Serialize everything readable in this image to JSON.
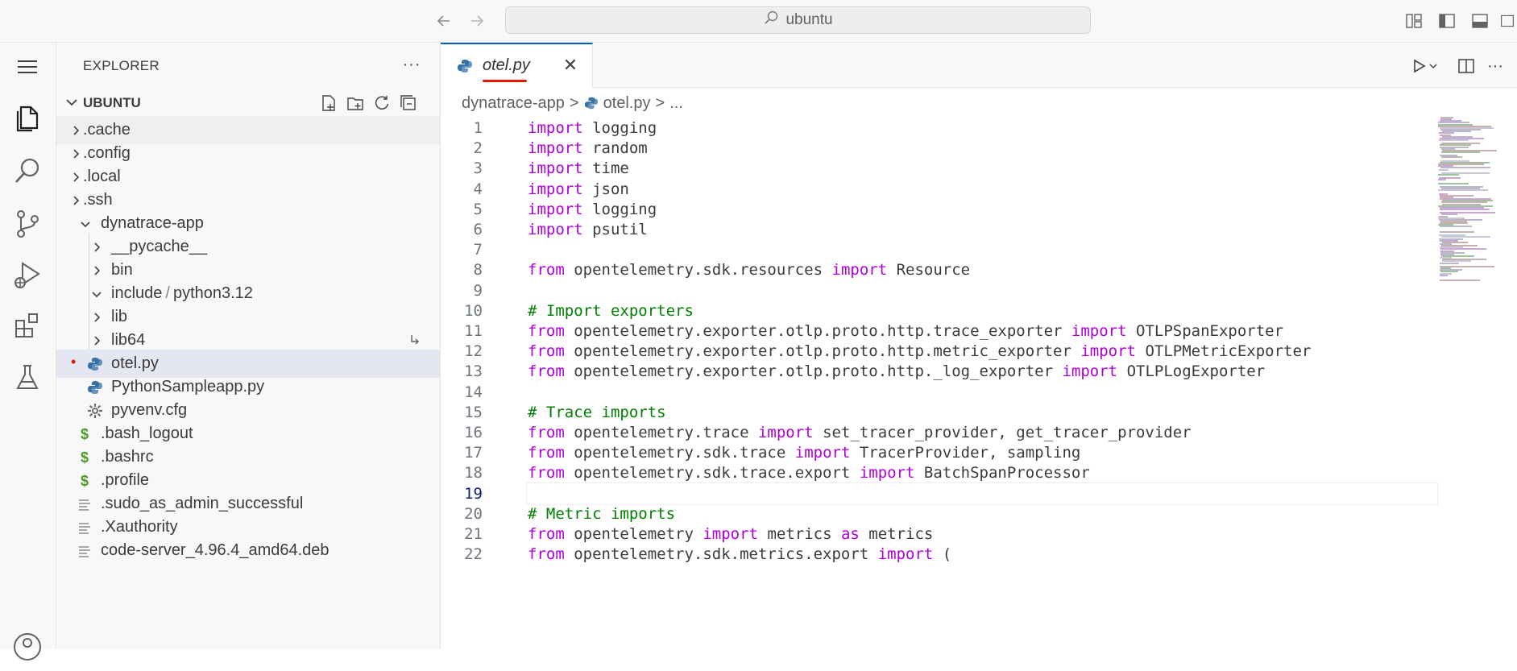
{
  "titlebar": {
    "search_text": "ubuntu",
    "icons": [
      "arrow-left-icon",
      "arrow-right-icon",
      "search-icon",
      "customize-layout-icon",
      "toggle-primary-sidebar-icon",
      "toggle-panel-icon",
      "toggle-secondary-sidebar-icon"
    ]
  },
  "activity_bar": {
    "items": [
      "menu",
      "explorer",
      "search",
      "source-control",
      "run-and-debug",
      "extensions",
      "testing",
      "accounts"
    ]
  },
  "sidebar": {
    "title": "EXPLORER",
    "workspace": "UBUNTU",
    "tree": [
      {
        "label": ".cache"
      },
      {
        "label": ".config"
      },
      {
        "label": ".local"
      },
      {
        "label": ".ssh"
      },
      {
        "label": "dynatrace-app"
      },
      {
        "label": "__pycache__"
      },
      {
        "label": "bin"
      },
      {
        "label": "include",
        "label2": "python3.12",
        "sep": "/"
      },
      {
        "label": "lib"
      },
      {
        "label": "lib64"
      },
      {
        "label": "otel.py",
        "status": "•"
      },
      {
        "label": "PythonSampleapp.py"
      },
      {
        "label": "pyvenv.cfg"
      },
      {
        "label": ".bash_logout",
        "icon": "$"
      },
      {
        "label": ".bashrc",
        "icon": "$"
      },
      {
        "label": ".profile",
        "icon": "$"
      },
      {
        "label": ".sudo_as_admin_successful"
      },
      {
        "label": ".Xauthority"
      },
      {
        "label": "code-server_4.96.4_amd64.deb"
      }
    ]
  },
  "editor": {
    "tab_label": "otel.py",
    "tab_close": "✕",
    "breadcrumb": [
      "dynatrace-app",
      ">",
      "otel.py",
      ">",
      "..."
    ],
    "current_line": 19,
    "lines": [
      {
        "n": "1",
        "t": "import logging"
      },
      {
        "n": "2",
        "t": "import random"
      },
      {
        "n": "3",
        "t": "import time"
      },
      {
        "n": "4",
        "t": "import json"
      },
      {
        "n": "5",
        "t": "import logging"
      },
      {
        "n": "6",
        "t": "import psutil"
      },
      {
        "n": "7",
        "t": ""
      },
      {
        "n": "8",
        "t": "from opentelemetry.sdk.resources import Resource"
      },
      {
        "n": "9",
        "t": ""
      },
      {
        "n": "10",
        "t": "# Import exporters"
      },
      {
        "n": "11",
        "t": "from opentelemetry.exporter.otlp.proto.http.trace_exporter import OTLPSpanExporter"
      },
      {
        "n": "12",
        "t": "from opentelemetry.exporter.otlp.proto.http.metric_exporter import OTLPMetricExporter"
      },
      {
        "n": "13",
        "t": "from opentelemetry.exporter.otlp.proto.http._log_exporter import OTLPLogExporter"
      },
      {
        "n": "14",
        "t": ""
      },
      {
        "n": "15",
        "t": "# Trace imports"
      },
      {
        "n": "16",
        "t": "from opentelemetry.trace import set_tracer_provider, get_tracer_provider"
      },
      {
        "n": "17",
        "t": "from opentelemetry.sdk.trace import TracerProvider, sampling"
      },
      {
        "n": "18",
        "t": "from opentelemetry.sdk.trace.export import BatchSpanProcessor"
      },
      {
        "n": "19",
        "t": ""
      },
      {
        "n": "20",
        "t": "# Metric imports"
      },
      {
        "n": "21",
        "t": "from opentelemetry import metrics as metrics"
      },
      {
        "n": "22",
        "t": "from opentelemetry.sdk.metrics.export import ("
      }
    ]
  },
  "colors": {
    "keyword": "#af00db",
    "comment": "#008000",
    "accent": "#005fb8",
    "modified": "#e51400"
  }
}
